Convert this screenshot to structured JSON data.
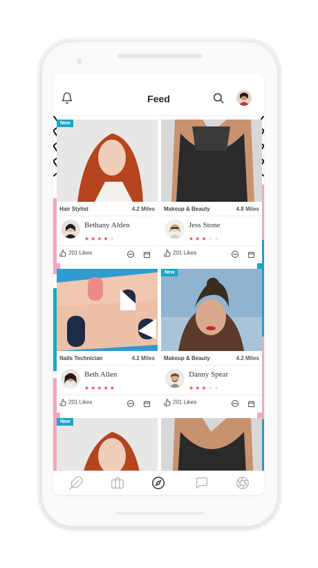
{
  "header": {
    "title": "Feed"
  },
  "cards": [
    {
      "badge": "New",
      "role": "Hair Stylist",
      "distance": "4.2 Miles",
      "name": "Bethany Alden",
      "rating": 4,
      "likes": "201 Likes"
    },
    {
      "badge": "",
      "role": "Makeup & Beauty",
      "distance": "4.8 Miles",
      "name": "Jess Stone",
      "rating": 3,
      "likes": "201 Likes"
    },
    {
      "badge": "",
      "role": "Nails Technician",
      "distance": "4.2 Miles",
      "name": "Beth Allen",
      "rating": 5,
      "likes": "201 Likes"
    },
    {
      "badge": "New",
      "role": "Makeup & Beauty",
      "distance": "4.2 Miles",
      "name": "Danny Spear",
      "rating": 3,
      "likes": "201 Likes"
    },
    {
      "badge": "New"
    }
  ],
  "icons": {
    "top_left": "bell-icon",
    "top_right": [
      "search-icon",
      "avatar"
    ],
    "card_actions": [
      "like-icon",
      "chat-icon",
      "calendar-icon"
    ],
    "tabbar": [
      "feather-icon",
      "briefcase-icon",
      "compass-icon",
      "chat-bubble-icon",
      "aperture-icon"
    ]
  },
  "colors": {
    "accent_badge": "#1aa5c9",
    "star_active": "#e84a5f",
    "star_inactive": "#e0e0e0"
  }
}
